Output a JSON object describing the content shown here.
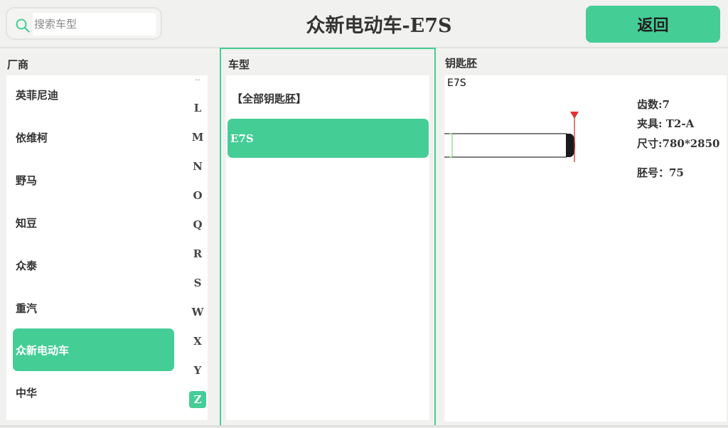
{
  "header": {
    "title": "众新电动车-E7S",
    "search_placeholder": "搜索车型",
    "back_label": "返回"
  },
  "columns": {
    "manufacturer": "厂商",
    "model": "车型",
    "key_blank": "钥匙胚"
  },
  "manufacturers": [
    "英菲尼迪",
    "依维柯",
    "野马",
    "知豆",
    "众泰",
    "重汽",
    "众新电动车",
    "中华"
  ],
  "selected_manufacturer": "众新电动车",
  "letter_index": [
    "L",
    "M",
    "N",
    "O",
    "Q",
    "R",
    "S",
    "W",
    "X",
    "Y",
    "Z"
  ],
  "selected_letter": "Z",
  "models": [
    "【全部钥匙胚】",
    "E7S"
  ],
  "selected_model": "E7S",
  "blank": {
    "name": "E7S",
    "teeth": "齿数:7",
    "clamp": "夹具: T2-A",
    "size": "尺寸:780*2850",
    "blank_no": "胚号：75"
  },
  "colors": {
    "accent": "#45cd96",
    "marker": "#e53030",
    "background": "#f1f1ef"
  }
}
